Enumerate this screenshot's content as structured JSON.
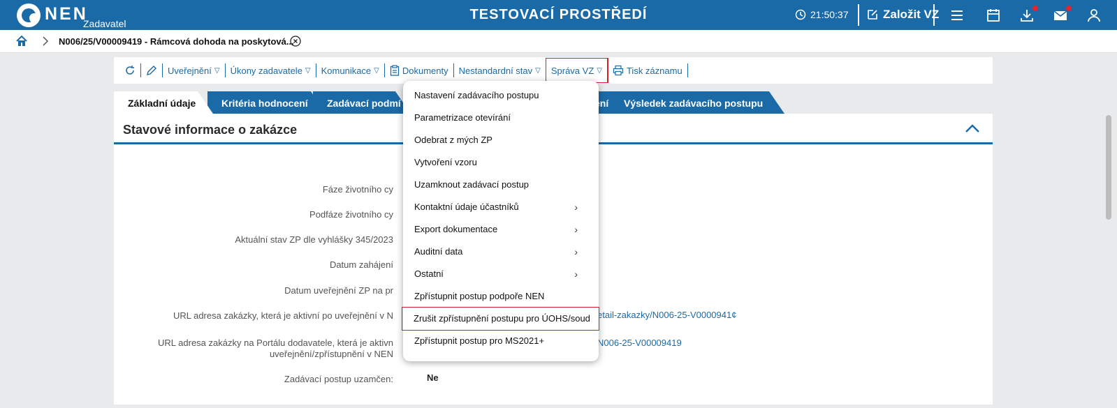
{
  "header": {
    "logo_text": "NEN",
    "logo_sub": "Zadavatel",
    "env_title": "TESTOVACÍ PROSTŘEDÍ",
    "clock": "21:50:37",
    "create_label": "Založit VZ"
  },
  "breadcrumb": {
    "text": "N006/25/V00009419 - Rámcová dohoda na poskytová..."
  },
  "toolbar": {
    "items": [
      "Uveřejnění",
      "Úkony zadavatele",
      "Komunikace",
      "Dokumenty",
      "Nestandardní stav",
      "Správa VZ",
      "Tisk záznamu"
    ]
  },
  "tabs": [
    "Základní údaje",
    "Kritéria hodnocení",
    "Zadávací podmí",
    "ení",
    "Výsledek zadávacího postupu"
  ],
  "panel": {
    "title": "Stavové informace o zakázce",
    "rows": [
      "Fáze životního cy",
      "Podfáze životního cy",
      "Aktuální stav ZP dle vyhlášky 345/2023",
      "Datum zahájení",
      "Datum uveřejnění ZP na pr",
      "URL adresa zakázky, která je aktivní po uveřejnění v N",
      "URL adresa zakázky na Portálu dodavatele, která je aktivn",
      "uveřejnění/zpřístupnění v NEN",
      "Zadávací postup uzamčen:"
    ],
    "link1": "etail-zakazky/N006-25-V0000941¢",
    "link2": "N006-25-V00009419",
    "locked_value": "Ne"
  },
  "menu": {
    "items": [
      {
        "label": "Nastavení zadávacího postupu",
        "submenu": false
      },
      {
        "label": "Parametrizace otevírání",
        "submenu": false
      },
      {
        "label": "Odebrat z mých ZP",
        "submenu": false
      },
      {
        "label": "Vytvoření vzoru",
        "submenu": false
      },
      {
        "label": "Uzamknout zadávací postup",
        "submenu": false
      },
      {
        "label": "Kontaktní údaje účastníků",
        "submenu": true
      },
      {
        "label": "Export dokumentace",
        "submenu": true
      },
      {
        "label": "Auditní data",
        "submenu": true
      },
      {
        "label": "Ostatní",
        "submenu": true
      },
      {
        "label": "Zpřístupnit postup podpoře NEN",
        "submenu": false
      },
      {
        "label": "Zrušit zpřístupnění postupu pro ÚOHS/soud",
        "submenu": false
      },
      {
        "label": "Zpřístupnit postup pro MS2021+",
        "submenu": false
      }
    ]
  },
  "colors": {
    "brand": "#1b6aa8",
    "highlight": "#d61f26",
    "badge": "#e0262f"
  }
}
